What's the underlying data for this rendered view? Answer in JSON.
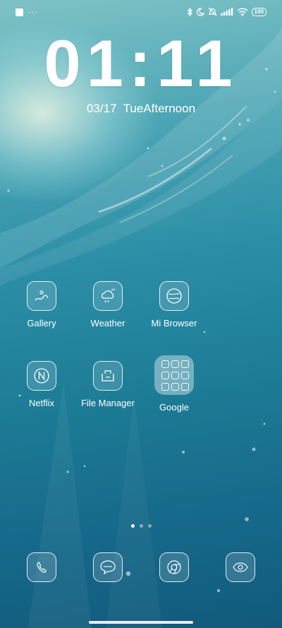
{
  "status_bar": {
    "notification_dots": "···",
    "battery_level": "100",
    "icons": [
      "bluetooth-icon",
      "do-not-disturb-moon-icon",
      "muted-bell-icon",
      "signal-bars-icon",
      "wifi-icon",
      "battery-icon"
    ]
  },
  "clock": {
    "time": "01:11",
    "date": "03/17  TueAfternoon"
  },
  "apps": [
    {
      "name": "Gallery",
      "icon": "gallery-icon"
    },
    {
      "name": "Weather",
      "icon": "weather-icon"
    },
    {
      "name": "Mi Browser",
      "icon": "browser-icon"
    },
    {
      "name": "Netflix",
      "icon": "netflix-icon"
    },
    {
      "name": "File Manager",
      "icon": "file-manager-icon"
    },
    {
      "name": "Google",
      "icon": "folder-icon"
    }
  ],
  "dock": [
    {
      "icon": "phone-icon"
    },
    {
      "icon": "messages-icon"
    },
    {
      "icon": "chrome-icon"
    },
    {
      "icon": "camera-icon"
    }
  ],
  "pager": {
    "pages": 3,
    "current": 1
  }
}
